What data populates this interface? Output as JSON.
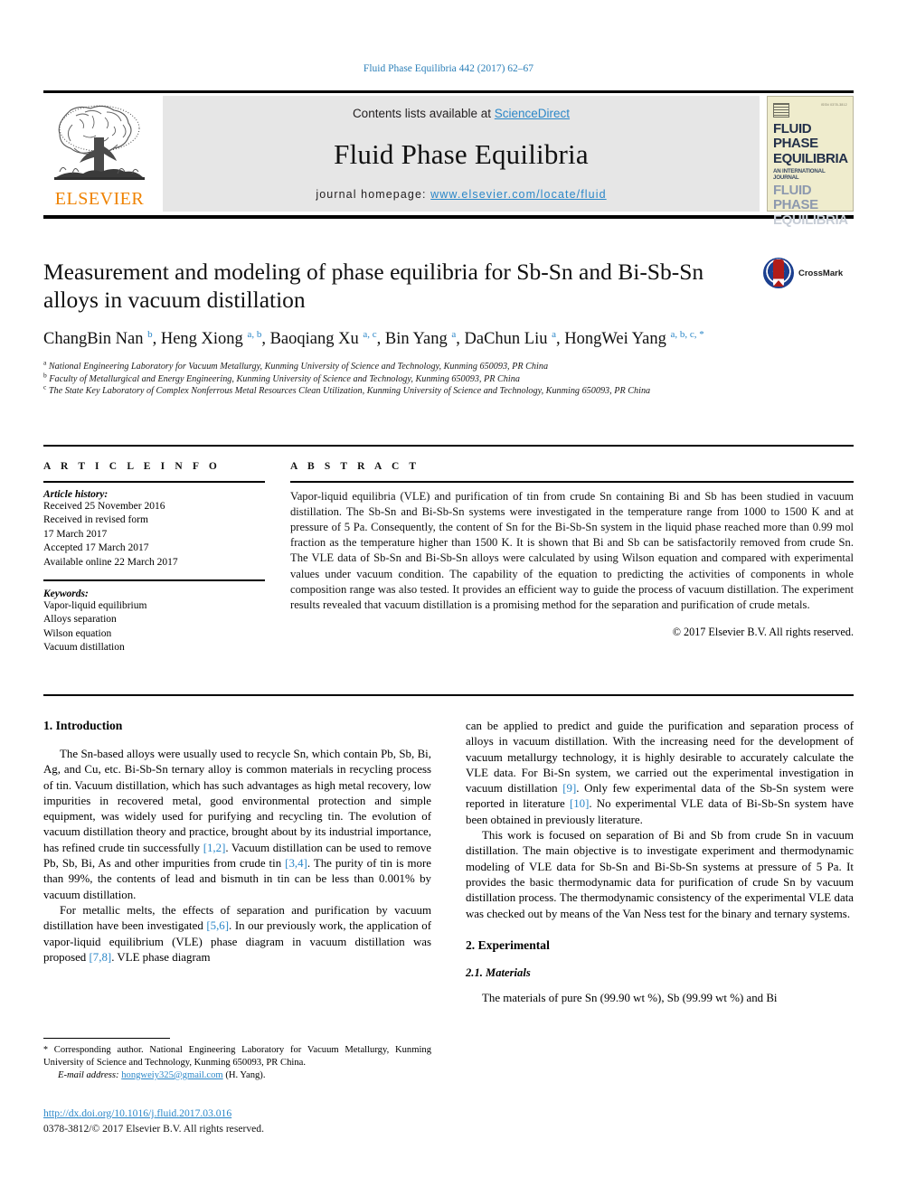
{
  "running_head": "Fluid Phase Equilibria 442 (2017) 62–67",
  "masthead": {
    "publisher_logo_text": "ELSEVIER",
    "contents_prefix": "Contents lists available at ",
    "contents_link": "ScienceDirect",
    "journal_name": "Fluid Phase Equilibria",
    "homepage_prefix": "journal homepage: ",
    "homepage_url": "www.elsevier.com/locate/fluid",
    "cover": {
      "line1": "FLUID PHASE",
      "line2": "EQUILIBRIA",
      "subtitle": "AN INTERNATIONAL JOURNAL",
      "line3": "FLUID PHASE",
      "line4": "EQUILIBRIA",
      "corner_label": "ISSN 0378-3812"
    }
  },
  "article": {
    "title": "Measurement and modeling of phase equilibria for Sb-Sn and Bi-Sb-Sn alloys in vacuum distillation",
    "crossmark_label": "CrossMark",
    "authors_html": "ChangBin Nan <sup>b</sup>, Heng Xiong <sup>a, b</sup>, Baoqiang Xu <sup>a, c</sup>, Bin Yang <sup>a</sup>, DaChun Liu <sup>a</sup>, HongWei Yang <sup>a, b, c, *</sup>",
    "affiliations": [
      {
        "marker": "a",
        "text": "National Engineering Laboratory for Vacuum Metallurgy, Kunming University of Science and Technology, Kunming 650093, PR China"
      },
      {
        "marker": "b",
        "text": "Faculty of Metallurgical and Energy Engineering, Kunming University of Science and Technology, Kunming 650093, PR China"
      },
      {
        "marker": "c",
        "text": "The State Key Laboratory of Complex Nonferrous Metal Resources Clean Utilization, Kunming University of Science and Technology, Kunming 650093, PR China"
      }
    ]
  },
  "article_info": {
    "heading": "A R T I C L E  I N F O",
    "history_label": "Article history:",
    "history": [
      "Received 25 November 2016",
      "Received in revised form",
      "17 March 2017",
      "Accepted 17 March 2017",
      "Available online 22 March 2017"
    ],
    "keywords_label": "Keywords:",
    "keywords": [
      "Vapor-liquid equilibrium",
      "Alloys separation",
      "Wilson equation",
      "Vacuum distillation"
    ]
  },
  "abstract": {
    "heading": "A B S T R A C T",
    "text": "Vapor-liquid equilibria (VLE) and purification of tin from crude Sn containing Bi and Sb has been studied in vacuum distillation. The Sb-Sn and Bi-Sb-Sn systems were investigated in the temperature range from 1000 to 1500 K and at pressure of 5 Pa. Consequently, the content of Sn for the Bi-Sb-Sn system in the liquid phase reached more than 0.99 mol fraction as the temperature higher than 1500 K. It is shown that Bi and Sb can be satisfactorily removed from crude Sn. The VLE data of Sb-Sn and Bi-Sb-Sn alloys were calculated by using Wilson equation and compared with experimental values under vacuum condition. The capability of the equation to predicting the activities of components in whole composition range was also tested. It provides an efficient way to guide the process of vacuum distillation. The experiment results revealed that vacuum distillation is a promising method for the separation and purification of crude metals.",
    "copyright": "© 2017 Elsevier B.V. All rights reserved."
  },
  "body": {
    "intro_heading": "1. Introduction",
    "intro_p1_a": "The Sn-based alloys were usually used to recycle Sn, which contain Pb, Sb, Bi, Ag, and Cu, etc. Bi-Sb-Sn ternary alloy is common materials in recycling process of tin. Vacuum distillation, which has such advantages as high metal recovery, low impurities in recovered metal, good environmental protection and simple equipment, was widely used for purifying and recycling tin. The evolution of vacuum distillation theory and practice, brought about by its industrial importance, has refined crude tin successfully ",
    "intro_p1_ref1": "[1,2]",
    "intro_p1_b": ". Vacuum distillation can be used to remove Pb, Sb, Bi, As and other impurities from crude tin ",
    "intro_p1_ref2": "[3,4]",
    "intro_p1_c": ". The purity of tin is more than 99%, the contents of lead and bismuth in tin can be less than 0.001% by vacuum distillation.",
    "intro_p2_a": "For metallic melts, the effects of separation and purification by vacuum distillation have been investigated ",
    "intro_p2_ref1": "[5,6]",
    "intro_p2_b": ". In our previously work, the application of vapor-liquid equilibrium (VLE) phase diagram in vacuum distillation was proposed ",
    "intro_p2_ref2": "[7,8]",
    "intro_p2_c": ". VLE phase diagram",
    "right_p1_a": "can be applied to predict and guide the purification and separation process of alloys in vacuum distillation. With the increasing need for the development of vacuum metallurgy technology, it is highly desirable to accurately calculate the VLE data. For Bi-Sn system, we carried out the experimental investigation in vacuum distillation ",
    "right_p1_ref1": "[9]",
    "right_p1_b": ". Only few experimental data of the Sb-Sn system were reported in literature ",
    "right_p1_ref2": "[10]",
    "right_p1_c": ". No experimental VLE data of Bi-Sb-Sn system have been obtained in previously literature.",
    "right_p2": "This work is focused on separation of Bi and Sb from crude Sn in vacuum distillation. The main objective is to investigate experiment and thermodynamic modeling of VLE data for Sb-Sn and Bi-Sb-Sn systems at pressure of 5 Pa. It provides the basic thermodynamic data for purification of crude Sn by vacuum distillation process. The thermodynamic consistency of the experimental VLE data was checked out by means of the Van Ness test for the binary and ternary systems.",
    "exp_heading": "2. Experimental",
    "materials_heading": "2.1. Materials",
    "materials_p": "The materials of pure Sn (99.90 wt %), Sb (99.99 wt %) and Bi"
  },
  "footer": {
    "corresponding_star": "*",
    "corresponding_text": " Corresponding author. National Engineering Laboratory for Vacuum Metallurgy, Kunming University of Science and Technology, Kunming 650093, PR China.",
    "email_label": "E-mail address:",
    "email": "hongweiy325@gmail.com",
    "email_suffix": "(H. Yang).",
    "doi": "http://dx.doi.org/10.1016/j.fluid.2017.03.016",
    "issn_line": "0378-3812/© 2017 Elsevier B.V. All rights reserved."
  },
  "colors": {
    "link_blue": "#2b87c8",
    "elsevier_orange": "#ef8200",
    "masthead_grey": "#e6e6e6",
    "crossmark_red": "#b01c18",
    "crossmark_blue": "#1b3f8f"
  }
}
